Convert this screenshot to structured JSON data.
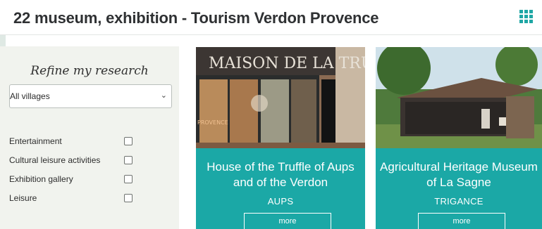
{
  "page": {
    "title": "22 museum, exhibition - Tourism Verdon Provence",
    "grid_icon": "grid-view-icon",
    "accent_color": "#1ba8a6"
  },
  "filters": {
    "heading": "Refine my research",
    "village_select": {
      "value": "All villages",
      "icon": "chevron-down-icon"
    },
    "categories": [
      {
        "label": "Entertainment",
        "checked": false
      },
      {
        "label": "Cultural leisure activities",
        "checked": false
      },
      {
        "label": "Exhibition gallery",
        "checked": false
      },
      {
        "label": "Leisure",
        "checked": false
      }
    ]
  },
  "cards": [
    {
      "title": "House of the Truffle of Aups\nand of the Verdon",
      "location": "AUPS",
      "more_label": "more",
      "photo_sign": "MAISON DE LA TRUFFE",
      "photo_window_text": "PROVENCE"
    },
    {
      "title": "Agricultural Heritage Museum\nof La Sagne",
      "location": "TRIGANCE",
      "more_label": "more"
    }
  ]
}
